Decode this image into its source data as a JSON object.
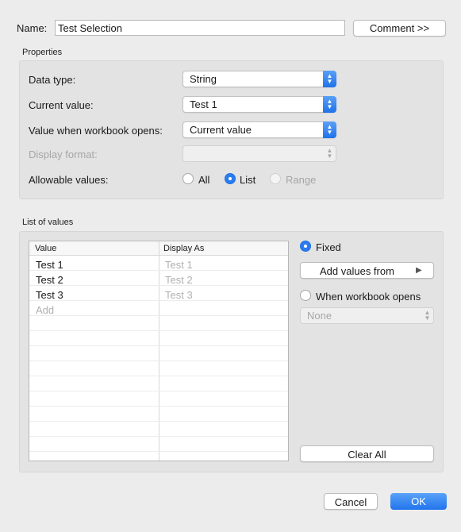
{
  "name_row": {
    "label": "Name:",
    "value": "Test Selection",
    "comment_button": "Comment >>"
  },
  "properties": {
    "section_label": "Properties",
    "data_type_label": "Data type:",
    "data_type_value": "String",
    "current_value_label": "Current value:",
    "current_value_value": "Test 1",
    "workbook_opens_label": "Value when workbook opens:",
    "workbook_opens_value": "Current value",
    "display_format_label": "Display format:",
    "display_format_value": "",
    "allowable_values_label": "Allowable values:",
    "allowable_options": [
      {
        "label": "All",
        "selected": false,
        "enabled": true
      },
      {
        "label": "List",
        "selected": true,
        "enabled": true
      },
      {
        "label": "Range",
        "selected": false,
        "enabled": false
      }
    ]
  },
  "list_of_values": {
    "section_label": "List of values",
    "columns": [
      "Value",
      "Display As"
    ],
    "rows": [
      {
        "value": "Test 1",
        "display": "Test 1"
      },
      {
        "value": "Test 2",
        "display": "Test 2"
      },
      {
        "value": "Test 3",
        "display": "Test 3"
      }
    ],
    "add_placeholder": "Add",
    "fixed_label": "Fixed",
    "add_values_from": "Add values from",
    "when_workbook_opens_label": "When workbook opens",
    "none_value": "None",
    "clear_all": "Clear All"
  },
  "footer": {
    "cancel": "Cancel",
    "ok": "OK"
  },
  "colors": {
    "accent": "#2a7cf0",
    "window_bg": "#ececec",
    "panel_bg": "#e3e3e3"
  }
}
